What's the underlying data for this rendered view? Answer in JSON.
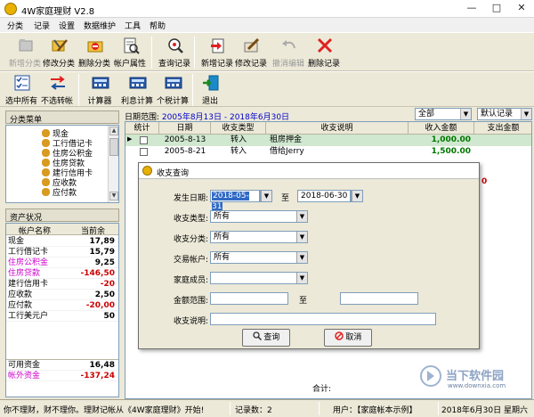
{
  "window": {
    "title": "4W家庭理财 V2.8"
  },
  "menu": [
    "分类",
    "记录",
    "设置",
    "数据维护",
    "工具",
    "帮助"
  ],
  "toolbar1": [
    {
      "label": "新增分类",
      "icon": "add-category-icon",
      "disabled": true
    },
    {
      "label": "修改分类",
      "icon": "edit-category-icon",
      "disabled": false
    },
    {
      "label": "删除分类",
      "icon": "delete-category-icon",
      "disabled": false
    },
    {
      "label": "帐户属性",
      "icon": "account-properties-icon",
      "disabled": false
    },
    {
      "label": "查询记录",
      "icon": "search-records-icon",
      "disabled": false
    },
    {
      "label": "新增记录",
      "icon": "add-record-icon",
      "disabled": false
    },
    {
      "label": "修改记录",
      "icon": "edit-record-icon",
      "disabled": false
    },
    {
      "label": "撤消编辑",
      "icon": "undo-icon",
      "disabled": true
    },
    {
      "label": "删除记录",
      "icon": "delete-record-icon",
      "disabled": false
    }
  ],
  "toolbar2": [
    {
      "label": "选中所有",
      "icon": "select-all-icon"
    },
    {
      "label": "不选转帐",
      "icon": "deselect-transfer-icon"
    },
    {
      "label": "计算器",
      "icon": "calculator-icon"
    },
    {
      "label": "利息计算",
      "icon": "interest-calc-icon"
    },
    {
      "label": "个税计算",
      "icon": "tax-calc-icon"
    },
    {
      "label": "退出",
      "icon": "exit-icon"
    }
  ],
  "category_menu": {
    "title": "分类菜单",
    "items": [
      "现金",
      "工行借记卡",
      "住房公积金",
      "住房贷款",
      "建行信用卡",
      "应收款",
      "应付款"
    ]
  },
  "asset_status": {
    "title": "资产状况",
    "headers": [
      "帐户名称",
      "当前余"
    ],
    "rows": [
      {
        "name": "现金",
        "value": "17,89",
        "color": "#000000",
        "nameColor": "#000000"
      },
      {
        "name": "工行借记卡",
        "value": "15,79",
        "color": "#000000",
        "nameColor": "#000000"
      },
      {
        "name": "住房公积金",
        "value": "9,25",
        "color": "#000000",
        "nameColor": "#cc00cc"
      },
      {
        "name": "住房贷款",
        "value": "-146,50",
        "color": "#cc0000",
        "nameColor": "#cc00cc"
      },
      {
        "name": "建行信用卡",
        "value": "-20",
        "color": "#cc0000",
        "nameColor": "#000000"
      },
      {
        "name": "应收款",
        "value": "2,50",
        "color": "#000000",
        "nameColor": "#000000"
      },
      {
        "name": "应付款",
        "value": "-20,00",
        "color": "#cc0000",
        "nameColor": "#000000"
      },
      {
        "name": "工行美元户",
        "value": "50",
        "color": "#000000",
        "nameColor": "#000000"
      }
    ],
    "footer": [
      {
        "name": "可用资金",
        "value": "16,48",
        "color": "#000000",
        "nameColor": "#000000"
      },
      {
        "name": "帐外资金",
        "value": "-137,24",
        "color": "#cc0000",
        "nameColor": "#cc00cc"
      }
    ]
  },
  "records": {
    "date_range_label": "日期范围:",
    "date_range_value": "2005年8月13日 - 2018年6月30日",
    "filter_value": "全部",
    "sort_value": "默认记录",
    "columns": [
      "统计",
      "日期",
      "收支类型",
      "收支说明",
      "收入金额",
      "支出金额"
    ],
    "rows": [
      {
        "date": "2005-8-13",
        "type": "转入",
        "desc": "租房押金",
        "income": "1,000.00",
        "expense": ""
      },
      {
        "date": "2005-8-21",
        "type": "转入",
        "desc": "借给Jerry",
        "income": "1,500.00",
        "expense": ""
      }
    ],
    "side_value": "0",
    "total_label": "合计:"
  },
  "dialog": {
    "title": "收支查询",
    "labels": {
      "date": "发生日期:",
      "to": "至",
      "type": "收支类型:",
      "category": "收支分类:",
      "account": "交易帐户:",
      "member": "家庭成员:",
      "amount": "金额范围:",
      "amount_to": "至",
      "desc": "收支说明:"
    },
    "values": {
      "date_from": "2018-05-31",
      "date_to": "2018-06-30",
      "type": "所有",
      "category": "所有",
      "account": "所有",
      "member": "",
      "amount_from": "",
      "amount_to": "",
      "desc": ""
    },
    "query_button": "查询",
    "cancel_button": "取消"
  },
  "statusbar": {
    "message": "你不理财，财不理你。理财记帐从《4W家庭理财》开始!",
    "record_count": "记录数：2",
    "user": "用户：【家庭帐本示例】",
    "date": "2018年6月30日 星期六"
  },
  "watermark": {
    "brand": "当下软件园",
    "url": "www.downxia.com"
  },
  "colors": {
    "selected_row": "#cfe8cf",
    "date_range": "#0000cc",
    "income": "#007700",
    "negative": "#cc0000",
    "magenta": "#cc00cc"
  }
}
